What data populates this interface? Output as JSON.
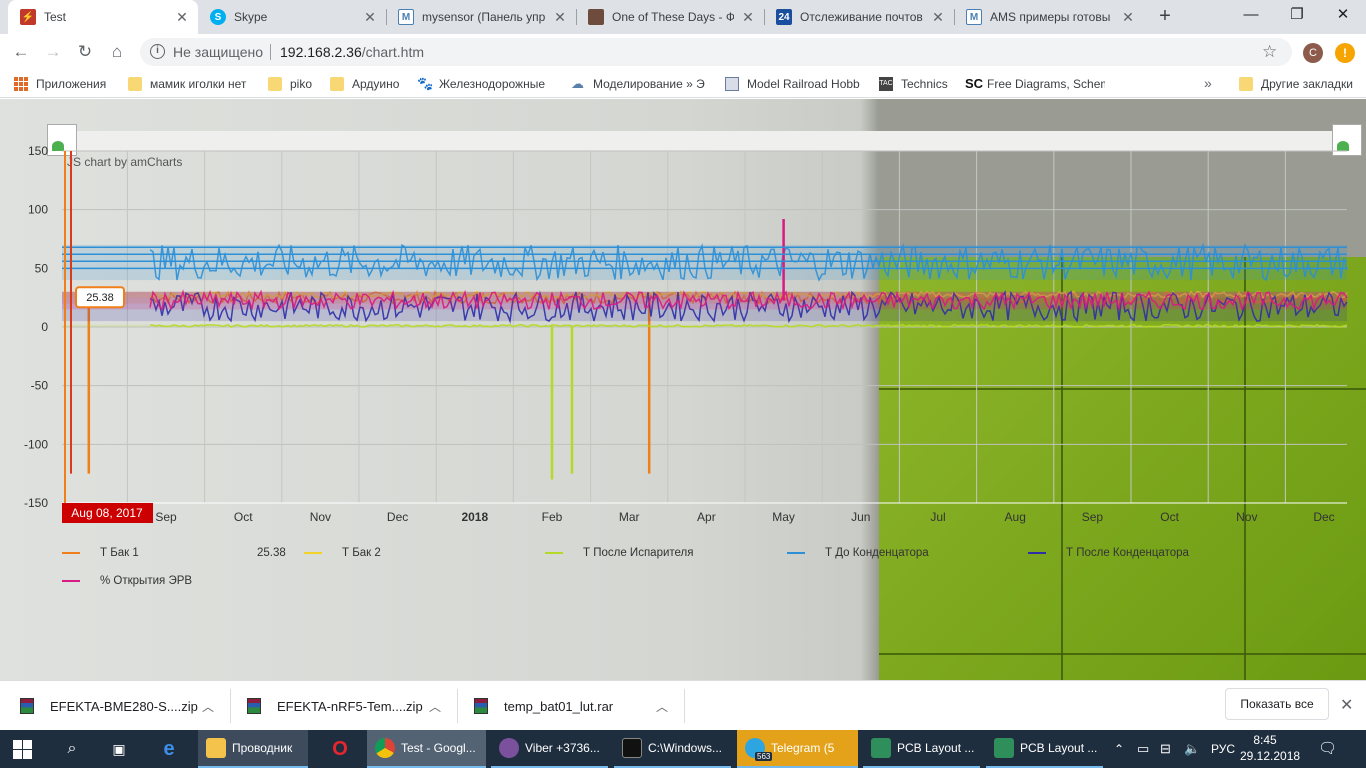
{
  "browser": {
    "tabs": [
      {
        "label": "Test",
        "active": true,
        "icon": "amcharts-icon"
      },
      {
        "label": "Skype",
        "active": false,
        "icon": "skype-icon"
      },
      {
        "label": "mysensor (Панель упр",
        "active": false,
        "icon": "mysensor-icon"
      },
      {
        "label": "One of These Days - Фа",
        "active": false,
        "icon": "photo-icon"
      },
      {
        "label": "Отслеживание почтов",
        "active": false,
        "icon": "tracking-icon"
      },
      {
        "label": "AMS примеры готовы",
        "active": false,
        "icon": "mysensor-icon"
      }
    ],
    "address": {
      "security": "Не защищено",
      "host": "192.168.2.36",
      "path": "/chart.htm"
    },
    "profile_letter": "C",
    "alert_symbol": "!",
    "bookmarks": [
      {
        "label": "Приложения",
        "icon": "apps-icon"
      },
      {
        "label": "мамик иголки нет",
        "icon": "folder-icon"
      },
      {
        "label": "piko",
        "icon": "folder-icon"
      },
      {
        "label": "Ардуино",
        "icon": "folder-icon"
      },
      {
        "label": "Железнодорожные",
        "icon": "paw-icon"
      },
      {
        "label": "Моделирование » Э",
        "icon": "cloud-icon"
      },
      {
        "label": "Model Railroad Hobb",
        "icon": "page-icon"
      },
      {
        "label": "Technics",
        "icon": "tac-icon"
      },
      {
        "label": "Free Diagrams, Schem",
        "icon": "sc-icon"
      }
    ],
    "more_bookmarks_symbol": "»",
    "other_bookmarks": "Другие закладки"
  },
  "chart_data": {
    "type": "line",
    "credit": "JS chart by amCharts",
    "ylim": [
      -150,
      150
    ],
    "y_ticks": [
      "150",
      "100",
      "50",
      "0",
      "-50",
      "-100",
      "-150"
    ],
    "x_ticks": [
      "Sep",
      "Oct",
      "Nov",
      "Dec",
      "2018",
      "Feb",
      "Mar",
      "Apr",
      "May",
      "Jun",
      "Jul",
      "Aug",
      "Sep",
      "Oct",
      "Nov",
      "Dec"
    ],
    "cursor_date": "Aug 08, 2017",
    "cursor_value": "25.38",
    "series": [
      {
        "name": "Т Бак 1",
        "color": "#f07f19",
        "value_label": "25.38",
        "typical": [
          20,
          30
        ],
        "spikes": [
          {
            "x": "Aug 2017",
            "y": -125
          },
          {
            "x": "Mar 2018",
            "y": -125
          }
        ]
      },
      {
        "name": "Т Бак 2",
        "color": "#f2d32a",
        "typical": [
          25,
          30
        ]
      },
      {
        "name": "Т После Испарителя",
        "color": "#b5d927",
        "typical": [
          0,
          2
        ],
        "spikes": [
          {
            "x": "Feb 2018",
            "y": -130
          },
          {
            "x": "Feb 2018",
            "y": -125
          }
        ]
      },
      {
        "name": "Т До Конденцатора",
        "color": "#2d8fd5",
        "typical": [
          40,
          70
        ]
      },
      {
        "name": "Т После Конденцатора",
        "color": "#2c2fa8",
        "typical": [
          5,
          30
        ]
      },
      {
        "name": "% Открытия ЭРВ",
        "color": "#d81b82",
        "typical": [
          15,
          30
        ],
        "spikes": [
          {
            "x": "May 2018",
            "y": 92
          }
        ]
      }
    ]
  },
  "downloads": {
    "items": [
      {
        "name": "EFEKTA-BME280-S....zip"
      },
      {
        "name": "EFEKTA-nRF5-Tem....zip"
      },
      {
        "name": "temp_bat01_lut.rar"
      }
    ],
    "show_all": "Показать все",
    "close_symbol": "✕"
  },
  "taskbar": {
    "apps": [
      {
        "label": "Проводник"
      },
      {
        "label": "Test - Googl..."
      },
      {
        "label": "Viber +3736..."
      },
      {
        "label": "C:\\Windows..."
      },
      {
        "label": "Telegram (5"
      },
      {
        "label": "PCB Layout ..."
      },
      {
        "label": "PCB Layout ..."
      }
    ],
    "telegram_badge": "563",
    "language": "РУС",
    "time": "8:45",
    "date": "29.12.2018"
  }
}
